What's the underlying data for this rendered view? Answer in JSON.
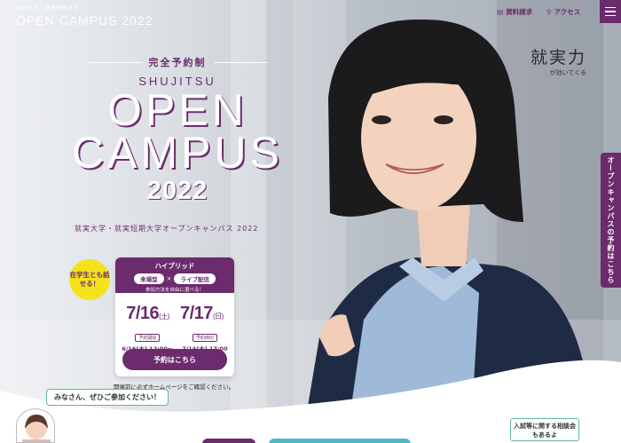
{
  "header": {
    "logo_small": "就実大学・就実短期大学",
    "logo_big": "OPEN CAMPUS 2022",
    "nav": [
      {
        "label": "資料請求",
        "icon": "document-icon"
      },
      {
        "label": "アクセス",
        "icon": "map-pin-icon"
      }
    ],
    "menu_icon": "hamburger-icon"
  },
  "slogan": {
    "main": "就実力",
    "sub": "が効いてくる"
  },
  "side_tab": "オープンキャンパスの予約はこちら",
  "hero": {
    "reservation_system": "完全予約制",
    "school": "SHUJITSU",
    "line1": "OPEN",
    "line2": "CAMPUS",
    "year": "2022",
    "subtitle": "就実大学・就実短期大学オープンキャンパス 2022"
  },
  "badge": "在学生とも話せる！",
  "event_card": {
    "type": "ハイブリッド",
    "option1": "来場型",
    "times": "×",
    "option2": "ライブ配信",
    "note": "参加方法を自由に選べる！",
    "date1": {
      "main": "7/16",
      "day": "(土)"
    },
    "date2": {
      "main": "7/17",
      "day": "(日)"
    },
    "start_label": "予約開始",
    "start_value": "6/16(木) 12:00〜",
    "end_label": "予約締切",
    "end_value": "7/14(木) 17:00",
    "button": "予約はこちら"
  },
  "card_note": "開催前に必ずホームページをご確認ください。",
  "bubble": "みなさん、ぜひご参加ください！",
  "consult": "入試等に関する相談会もあるよ",
  "colors": {
    "brand": "#6b2b6d",
    "accent": "#f6e21c",
    "teal": "#4fb8c6",
    "green": "#5fbc8f"
  }
}
